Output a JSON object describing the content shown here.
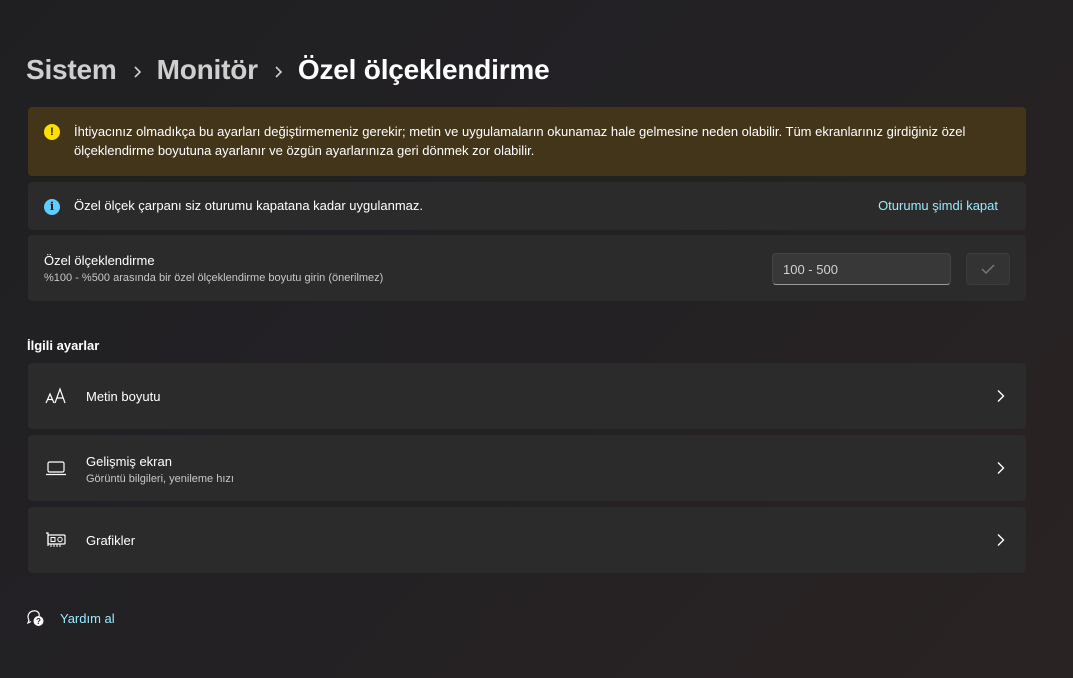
{
  "breadcrumb": {
    "items": [
      "Sistem",
      "Monitör"
    ],
    "current": "Özel ölçeklendirme"
  },
  "warning": {
    "icon": "warning-icon",
    "text": "İhtiyacınız olmadıkça bu ayarları değiştirmemeniz gerekir; metin ve uygulamaların okunamaz hale gelmesine neden olabilir. Tüm ekranlarınız girdiğiniz özel ölçeklendirme boyutuna ayarlanır ve özgün ayarlarınıza geri dönmek zor olabilir.",
    "color": "#433519",
    "icon_color": "#fce100"
  },
  "info": {
    "icon": "info-icon",
    "text": "Özel ölçek çarpanı siz oturumu kapatana kadar uygulanmaz.",
    "link": "Oturumu şimdi kapat",
    "icon_color": "#60cdff"
  },
  "custom_scaling": {
    "title": "Özel ölçeklendirme",
    "subtitle": "%100 - %500 arasında bir özel ölçeklendirme boyutu girin (önerilmez)",
    "input_value": "",
    "input_placeholder": "100 - 500",
    "apply_icon": "checkmark-icon"
  },
  "related": {
    "title": "İlgili ayarlar",
    "items": [
      {
        "icon": "text-size-icon",
        "title": "Metin boyutu",
        "subtitle": ""
      },
      {
        "icon": "laptop-icon",
        "title": "Gelişmiş ekran",
        "subtitle": "Görüntü bilgileri, yenileme hızı"
      },
      {
        "icon": "graphics-card-icon",
        "title": "Grafikler",
        "subtitle": ""
      }
    ]
  },
  "help": {
    "icon": "help-chat-icon",
    "label": "Yardım al"
  },
  "colors": {
    "accent_link": "#99ebff",
    "card": "#2b2b2b"
  }
}
